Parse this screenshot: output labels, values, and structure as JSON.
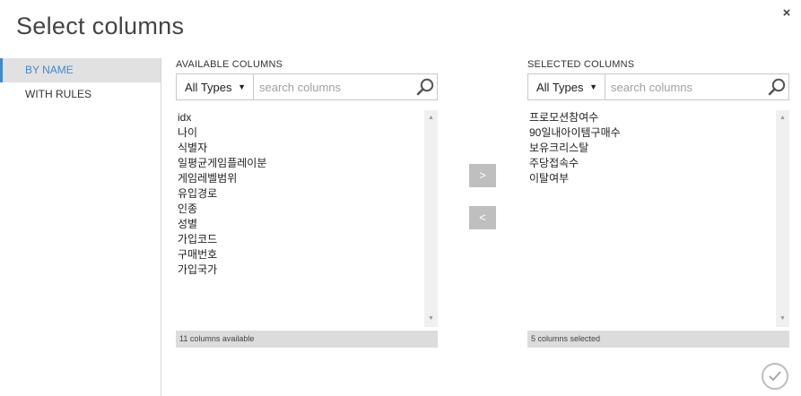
{
  "dialog": {
    "title": "Select columns",
    "close_label": "×"
  },
  "sidebar": {
    "items": [
      {
        "label": "BY NAME",
        "active": true
      },
      {
        "label": "WITH RULES",
        "active": false
      }
    ]
  },
  "available": {
    "heading": "AVAILABLE COLUMNS",
    "type_filter": "All Types",
    "search_placeholder": "search columns",
    "columns": [
      "idx",
      "나이",
      "식별자",
      "일평균게임플레이분",
      "게임레벨범위",
      "유입경로",
      "인종",
      "성별",
      "가입코드",
      "구매번호",
      "가입국가"
    ],
    "status": "11 columns available"
  },
  "selected": {
    "heading": "SELECTED COLUMNS",
    "type_filter": "All Types",
    "search_placeholder": "search columns",
    "columns": [
      "프로모션참여수",
      "90일내아이템구매수",
      "보유크리스탈",
      "주당접속수",
      "이탈여부"
    ],
    "status": "5 columns selected"
  },
  "actions": {
    "move_right_label": ">",
    "move_left_label": "<"
  },
  "icons": {
    "close": "close-icon",
    "search": "search-icon",
    "caret": "chevron-down-icon",
    "ok": "checkmark-icon"
  },
  "colors": {
    "accent": "#3f8ad0",
    "active_bg": "#e1e1e1",
    "move_button": "#bfbfbf",
    "status_bar": "#dcdcdc"
  }
}
